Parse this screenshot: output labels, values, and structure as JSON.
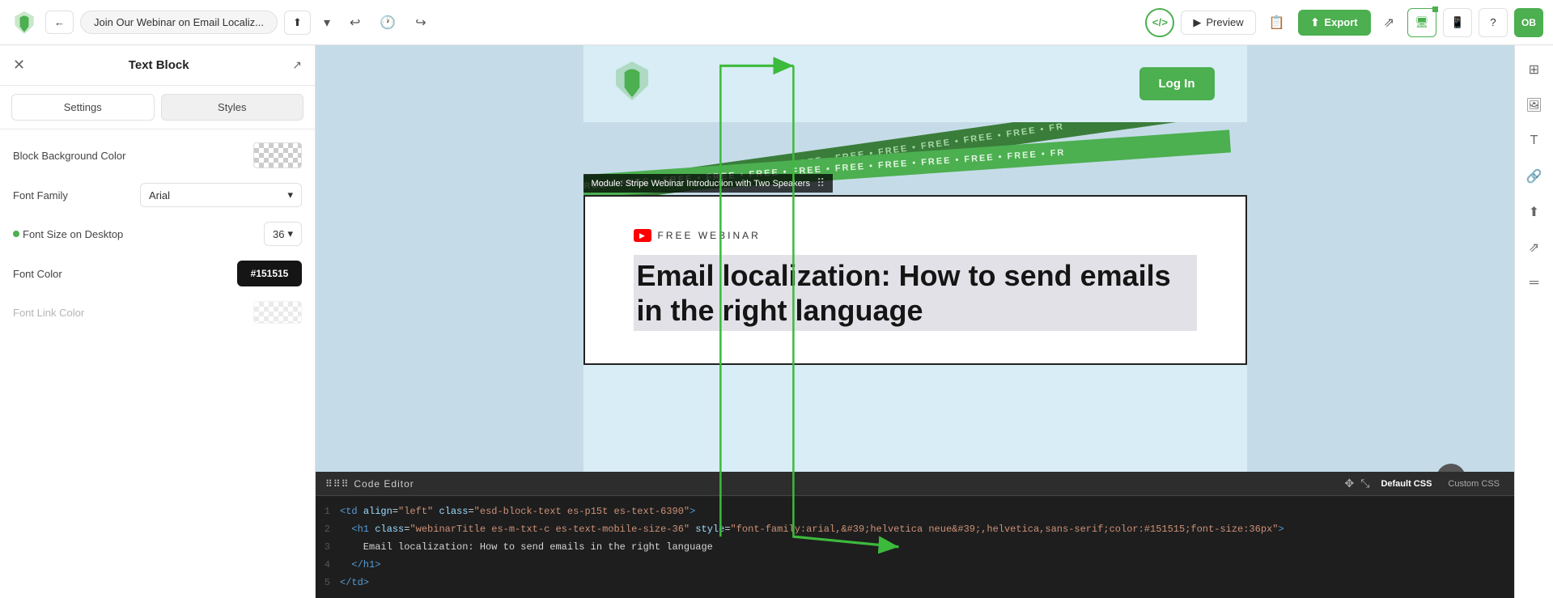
{
  "toolbar": {
    "title": "Join Our Webinar on Email Localiz...",
    "preview_label": "Preview",
    "export_label": "Export",
    "avatar": "OB",
    "undo_icon": "↩",
    "redo_icon": "↪",
    "history_icon": "🕐",
    "upload_icon": "⬆",
    "dropdown_icon": "▾",
    "code_icon": "</>",
    "share_icon": "⇥",
    "desktop_icon": "🖥",
    "mobile_icon": "📱",
    "help_icon": "?"
  },
  "left_panel": {
    "title": "Text Block",
    "tabs": [
      "Settings",
      "Styles"
    ],
    "active_tab": "Styles",
    "fields": {
      "block_bg_color_label": "Block Background Color",
      "font_family_label": "Font Family",
      "font_family_value": "Arial",
      "font_size_label": "Font Size on Desktop",
      "font_size_value": "36",
      "font_color_label": "Font Color",
      "font_color_value": "#151515"
    }
  },
  "email": {
    "login_btn": "Log In",
    "ribbon_text": "• FREE • FREE • FREE • FREE • FREE • FREE • FREE • FREE • FREE • FREE • FREE • FR",
    "module_label": "Module: Stripe Webinar Introduction with Two Speakers",
    "webinar_badge": "FREE WEBINAR",
    "headline": "Email localization: How to send emails in the right language"
  },
  "code_editor": {
    "title": "Code Editor",
    "tabs": [
      "Default CSS",
      "Custom CSS"
    ],
    "active_tab": "Default CSS",
    "lines": [
      {
        "num": "1",
        "content": "<td align=\"left\" class=\"esd-block-text es-p15t es-text-6390\">"
      },
      {
        "num": "2",
        "content": "  <h1 class=\"webinarTitle es-m-txt-c es-text-mobile-size-36\" style=\"font-family:arial,&#39;helvetica neue&#39;,helvetica,sans-serif;color:#151515;font-size:36px\">"
      },
      {
        "num": "3",
        "content": "    Email localization: How to send emails in the right language"
      },
      {
        "num": "4",
        "content": "  </h1>"
      },
      {
        "num": "5",
        "content": "</td>"
      }
    ]
  },
  "right_panel": {
    "icons": [
      "grid",
      "image",
      "text",
      "link",
      "layout",
      "share",
      "divider"
    ]
  }
}
